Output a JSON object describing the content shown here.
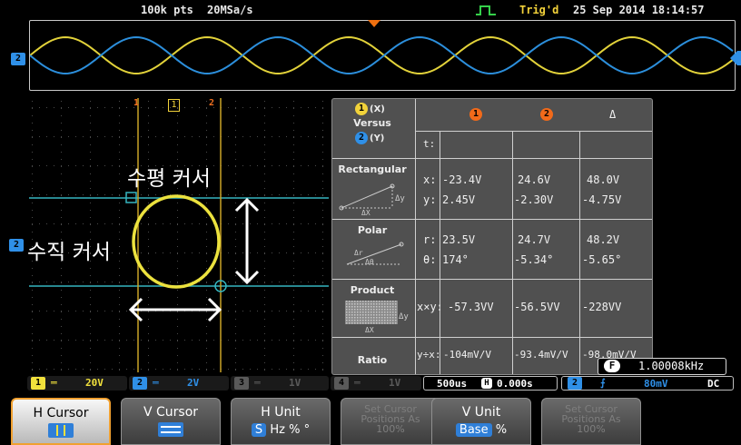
{
  "status": {
    "points": "100k pts",
    "sample_rate": "20MSa/s",
    "trigger_status": "Trig'd",
    "datetime": "25 Sep 2014 18:14:57",
    "trigger_icon": "rising-edge-trigger-icon"
  },
  "overview": {
    "channel_marker": "2"
  },
  "xy_plot": {
    "cursor_markers": [
      "1",
      "1",
      "2"
    ],
    "channel_marker": "2",
    "annotations": {
      "horizontal_cursor": "수평 커서",
      "vertical_cursor": "수직 커서"
    }
  },
  "cursor_table": {
    "header": {
      "x_label": "(X)",
      "versus": "Versus",
      "y_label": "(Y)",
      "col1": "1",
      "col2": "2",
      "delta": "Δ",
      "t_label": "t:"
    },
    "rectangular": {
      "label": "Rectangular",
      "x_label": "x:",
      "y_label": "y:",
      "x": [
        "-23.4V",
        "24.6V",
        "48.0V"
      ],
      "y": [
        "2.45V",
        "-2.30V",
        "-4.75V"
      ],
      "dx": "ΔX",
      "dy": "Δy"
    },
    "polar": {
      "label": "Polar",
      "r_label": "r:",
      "theta_label": "θ:",
      "r": [
        "23.5V",
        "24.7V",
        "48.2V"
      ],
      "theta": [
        "174°",
        "-5.34°",
        "-5.65°"
      ],
      "dr": "Δr",
      "dtheta": "Δθ"
    },
    "product": {
      "label": "Product",
      "expr": "x×y:",
      "values": [
        "-57.3VV",
        "-56.5VV",
        "-228VV"
      ],
      "dx": "ΔX",
      "dy": "Δy"
    },
    "ratio": {
      "label": "Ratio",
      "expr": "y÷x:",
      "values": [
        "-104mV/V",
        "-93.4mV/V",
        "-98.0mV/V"
      ]
    }
  },
  "frequency": {
    "key": "F",
    "value": "1.00008kHz"
  },
  "channels": [
    {
      "num": "1",
      "scale": "20V",
      "color": "#f1e13c"
    },
    {
      "num": "2",
      "scale": "2V",
      "color": "#2f90e8"
    },
    {
      "num": "3",
      "scale": "1V",
      "color": "#6a6a6a"
    },
    {
      "num": "4",
      "scale": "1V",
      "color": "#6a6a6a"
    }
  ],
  "timebase": {
    "scale": "500us",
    "h_icon": "H",
    "position": "0.000s"
  },
  "trigger_info": {
    "channel": "2",
    "slope_icon": "rising-slope-icon",
    "level": "80mV",
    "coupling": "DC"
  },
  "softkeys": {
    "h_cursor": "H Cursor",
    "v_cursor": "V Cursor",
    "h_unit": "H Unit",
    "h_unit_opts": [
      "S",
      "Hz",
      "%",
      "°"
    ],
    "set_cursor_100_h": "Set Cursor Positions As 100%",
    "v_unit": "V Unit",
    "v_unit_opts": [
      "Base",
      "%"
    ],
    "set_cursor_100_v": "Set Cursor Positions As 100%"
  }
}
